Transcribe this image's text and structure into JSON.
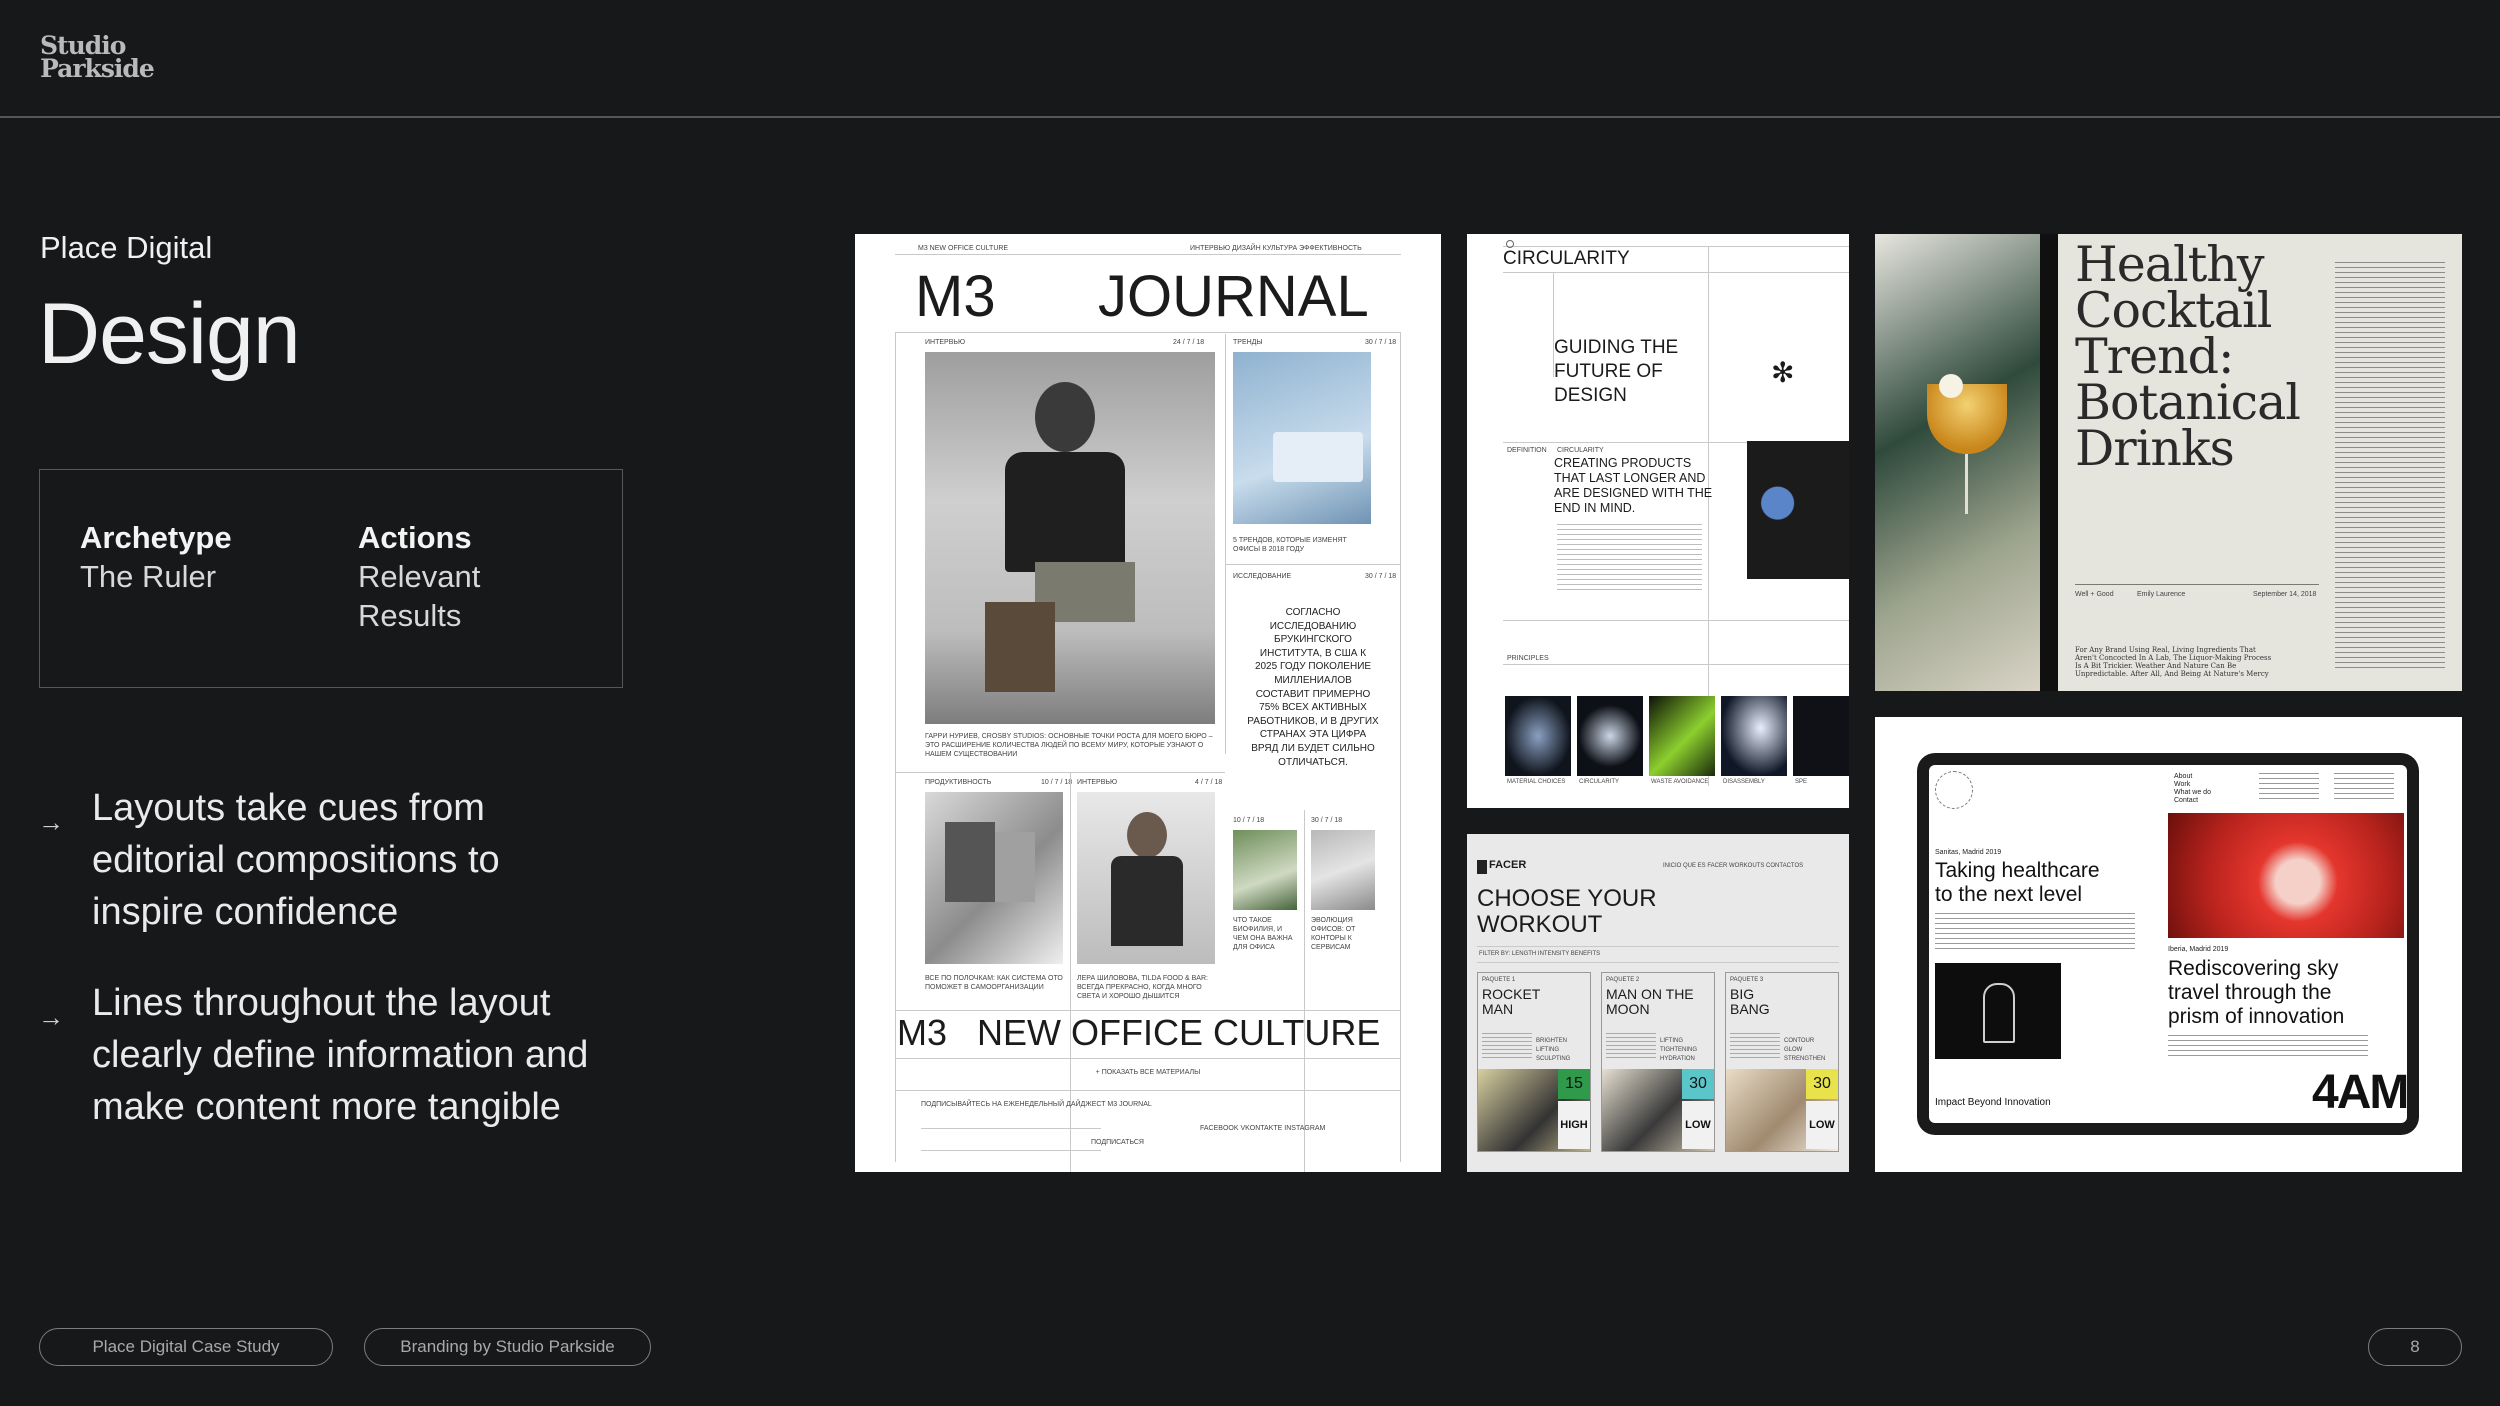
{
  "logo": {
    "line1": "Studio",
    "line2": "Parkside"
  },
  "header": {
    "subtitle": "Place Digital",
    "title": "Design"
  },
  "infobox": {
    "col1": {
      "heading": "Archetype",
      "text": "The Ruler"
    },
    "col2": {
      "heading": "Actions",
      "line1": "Relevant",
      "line2": "Results"
    }
  },
  "bullets": [
    {
      "arrow": "→",
      "line1": "Layouts take cues from",
      "line2": "editorial compositions to",
      "line3": "inspire confidence"
    },
    {
      "arrow": "→",
      "line1": "Lines throughout the layout",
      "line2": "clearly define information and",
      "line3": "make content more tangible"
    }
  ],
  "footer": {
    "pill1": "Place Digital Case Study",
    "pill2": "Branding by Studio Parkside",
    "page": "8"
  },
  "journal": {
    "small_head": "M3 NEW OFFICE CULTURE",
    "nav": "ИНТЕРВЬЮ   ДИЗАЙН   КУЛЬТУРА   ЭФФЕКТИВНОСТЬ",
    "m3": "M3",
    "journal": "JOURNAL",
    "col_a_label": "ИНТЕРВЬЮ",
    "col_a_date": "24 / 7 / 18",
    "col_b_label": "ТРЕНДЫ",
    "col_b_date": "30 / 7 / 18",
    "caption_a": "ГАРРИ НУРИЕВ, CROSBY STUDIOS: ОСНОВНЫЕ ТОЧКИ РОСТА ДЛЯ МОЕГО БЮРО – ЭТО РАСШИРЕНИЕ КОЛИЧЕСТВА ЛЮДЕЙ ПО ВСЕМУ МИРУ, КОТОРЫЕ УЗНАЮТ О НАШЕМ СУЩЕСТВОВАНИИ",
    "caption_b": "5 ТРЕНДОВ, КОТОРЫЕ ИЗМЕНЯТ ОФИСЫ В 2018 ГОДУ",
    "research_label": "ИССЛЕДОВАНИЕ",
    "research_date": "30 / 7 / 18",
    "quote_l1": "СОГЛАСНО",
    "quote_l2": "ИССЛЕДОВАНИЮ",
    "quote_l3": "БРУКИНГСКОГО",
    "quote_l4": "ИНСТИТУТА, В США К",
    "quote_l5": "2025 ГОДУ ПОКОЛЕНИЕ",
    "quote_l6": "МИЛЛЕНИАЛОВ",
    "quote_l7": "СОСТАВИТ ПРИМЕРНО",
    "quote_l8": "75% ВСЕХ АКТИВНЫХ",
    "quote_l9": "РАБОТНИКОВ, И В ДРУГИХ",
    "quote_l10": "СТРАНАХ ЭТА ЦИФРА",
    "quote_l11": "ВРЯД ЛИ БУДЕТ СИЛЬНО",
    "quote_l12": "ОТЛИЧАТЬСЯ.",
    "prod_label": "ПРОДУКТИВНОСТЬ",
    "prod_date": "10 / 7 / 18",
    "int_label": "ИНТЕРВЬЮ",
    "int_date": "4 / 7 / 18",
    "cap_c": "ВСЕ ПО ПОЛОЧКАМ: КАК СИСТЕМА ОТО ПОМОЖЕТ В САМООРГАНИЗАЦИИ",
    "cap_d": "ЛЕРА ШИЛОВОВА, TILDA FOOD & BAR: ВСЕГДА ПРЕКРАСНО, КОГДА МНОГО СВЕТА И ХОРОШО ДЫШИТСЯ",
    "date_e": "10 / 7 / 18",
    "date_f": "30 / 7 / 18",
    "cap_e": "ЧТО ТАКОЕ БИОФИЛИЯ, И ЧЕМ ОНА ВАЖНА ДЛЯ ОФИСА",
    "cap_f": "ЭВОЛЮЦИЯ ОФИСОВ: ОТ КОНТОРЫ К СЕРВИСАМ",
    "footer_m3": "M3",
    "footer_title": "NEW OFFICE CULTURE",
    "show_all": "+ ПОКАЗАТЬ ВСЕ МАТЕРИАЛЫ",
    "subscribe": "ПОДПИСЫВАЙТЕСЬ НА ЕЖЕНЕДЕЛЬНЫЙ ДАЙДЖЕСТ M3 JOURNAL",
    "subscribe_btn": "ПОДПИСАТЬСЯ",
    "social": "FACEBOOK   VKONTAKTE   INSTAGRAM"
  },
  "circularity": {
    "title": "CIRCULARITY",
    "h1": "GUIDING THE",
    "h2": "FUTURE OF",
    "h3": "DESIGN",
    "definition": "DEFINITION",
    "circ_small": "CIRCULARITY",
    "p1": "CREATING PRODUCTS",
    "p2": "THAT LAST LONGER AND",
    "p3": "ARE DESIGNED WITH THE",
    "p4": "END IN MIND.",
    "principles": "PRINCIPLES",
    "thumbs": [
      "MATERIAL CHOICES",
      "CIRCULARITY",
      "WASTE AVOIDANCE",
      "DISASSEMBLY",
      "SPE"
    ]
  },
  "cocktail": {
    "t1": "Healthy",
    "t2": "Cocktail",
    "t3": "Trend:",
    "t4": "Botanical",
    "t5": "Drinks",
    "meta1": "Well + Good",
    "meta2": "Emily Laurence",
    "meta3": "September 14, 2018",
    "footnote": "For Any Brand Using Real, Living Ingredients That Aren't Concocted In A Lab, The Liquor-Making Process Is A Bit Trickier. Weather And Nature Can Be Unpredictable. After All, And Being At Nature's Mercy"
  },
  "facer": {
    "brand": "FACER",
    "nav": "INICIO   QUE ES FACER   WORKOUTS   CONTACTOS",
    "h1": "CHOOSE YOUR",
    "h2": "WORKOUT",
    "filter": "FILTER BY:   LENGTH   INTENSITY   BENEFITS",
    "cards": [
      {
        "tag": "PAQUETE 1",
        "n1": "ROCKET",
        "n2": "MAN",
        "benefit": "BRIGHTEN LIFTING SCULPTING",
        "num": "15",
        "level": "HIGH",
        "accent": "#2f9a4a"
      },
      {
        "tag": "PAQUETE 2",
        "n1": "MAN ON THE",
        "n2": "MOON",
        "benefit": "LIFTING TIGHTENING HYDRATION",
        "num": "30",
        "level": "LOW",
        "accent": "#5bc6c9"
      },
      {
        "tag": "PAQUETE 3",
        "n1": "BIG",
        "n2": "BANG",
        "benefit": "CONTOUR GLOW STRENGTHEN",
        "num": "30",
        "level": "LOW",
        "accent": "#e8e34a"
      }
    ]
  },
  "fouram": {
    "date1": "Sanitas, Madrid 2019",
    "h1": "Taking healthcare",
    "h2": "to the next level",
    "nav1": "About",
    "nav2": "Work",
    "nav3": "What we do",
    "nav4": "Contact",
    "date2": "Iberia, Madrid 2019",
    "r1": "Rediscovering sky",
    "r2": "travel through the",
    "r3": "prism of innovation",
    "impact": "Impact Beyond Innovation",
    "logo": "4AM"
  },
  "colors": {
    "bg": "#17181a",
    "line": "#55575b",
    "text": "#e9e9ea",
    "accent_red": "#e4362d"
  }
}
